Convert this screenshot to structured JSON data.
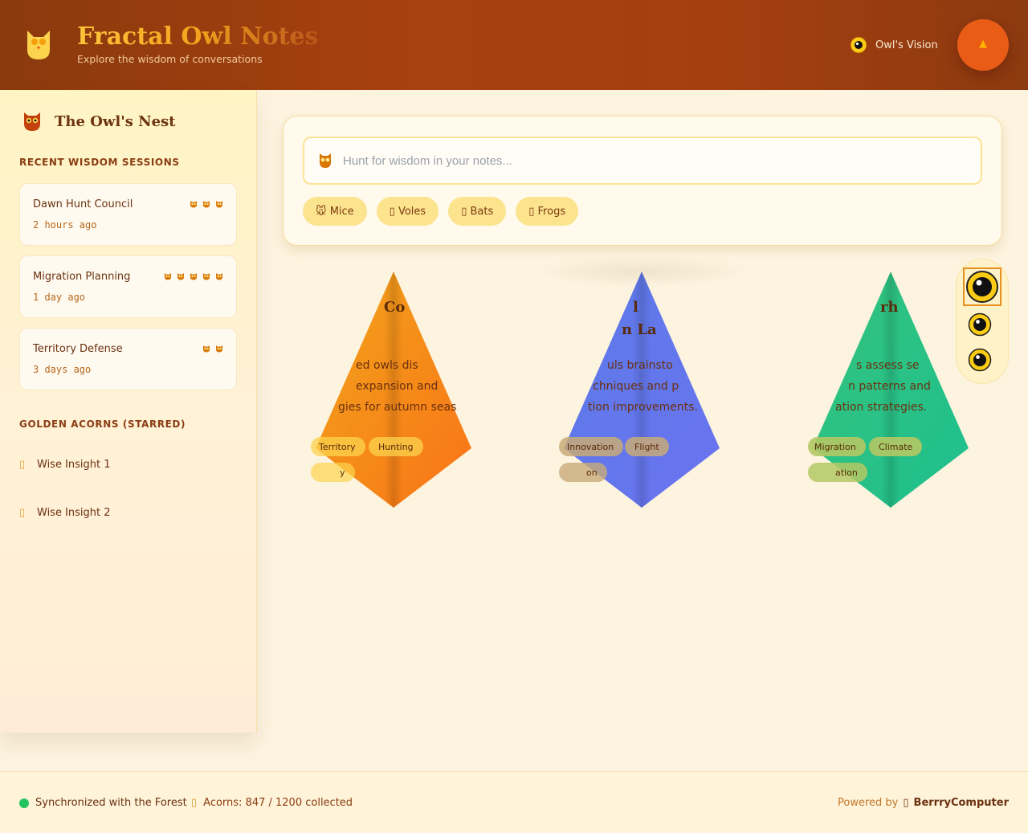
{
  "header": {
    "title": "Fractal Owl Notes",
    "subtitle": "Explore the wisdom of conversations",
    "vision_label": "Owl's Vision",
    "fab_glyph": "▲"
  },
  "sidebar": {
    "nest_title": "The Owl's Nest",
    "recent_title": "RECENT WISDOM SESSIONS",
    "sessions": [
      {
        "title": "Dawn Hunt Council",
        "time": "2 hours ago",
        "owl_count": 3
      },
      {
        "title": "Migration Planning",
        "time": "1 day ago",
        "owl_count": 5
      },
      {
        "title": "Territory Defense",
        "time": "3 days ago",
        "owl_count": 2
      }
    ],
    "starred_title": "GOLDEN ACORNS (STARRED)",
    "starred": [
      {
        "glyph": "▯",
        "label": "Wise Insight 1"
      },
      {
        "glyph": "▯",
        "label": "Wise Insight 2"
      }
    ]
  },
  "search": {
    "placeholder": "Hunt for wisdom in your notes...",
    "chips": [
      {
        "label": "🐭 Mice"
      },
      {
        "label": "▯ Voles"
      },
      {
        "label": "▯ Bats"
      },
      {
        "label": "▯ Frogs"
      }
    ]
  },
  "cards": [
    {
      "title": "Co",
      "desc": [
        "ed owls dis",
        "expansion and",
        "gies for autumn seas"
      ],
      "tags": [
        "Territory",
        "Hunting",
        "y"
      ],
      "colors": [
        "#f2a51c",
        "#f97316"
      ]
    },
    {
      "title_lines": [
        "l",
        "n La"
      ],
      "desc": [
        "uls brainsto",
        "chniques and p",
        "tion improvements."
      ],
      "tags": [
        "Innovation",
        "Flight",
        "on"
      ],
      "colors": [
        "#5b7be8",
        "#6b73f0"
      ]
    },
    {
      "title": "rh",
      "desc": [
        "s assess se",
        "n patterns and",
        "ation strategies."
      ],
      "tags": [
        "Migration",
        "Climate",
        "ation"
      ],
      "colors": [
        "#34c47c",
        "#1fbf8f"
      ]
    }
  ],
  "footer": {
    "sync_label": "Synchronized with the Forest",
    "acorn_glyph": "▯",
    "acorns_label": "Acorns: 847 / 1200 collected",
    "powered_label": "Powered by",
    "brand_glyph": "▯",
    "brand": "BerrryComputer"
  },
  "colors": {
    "accent": "#e85c16",
    "header": "#a8400f",
    "chip": "#fce38e",
    "sync": "#22c55e"
  }
}
